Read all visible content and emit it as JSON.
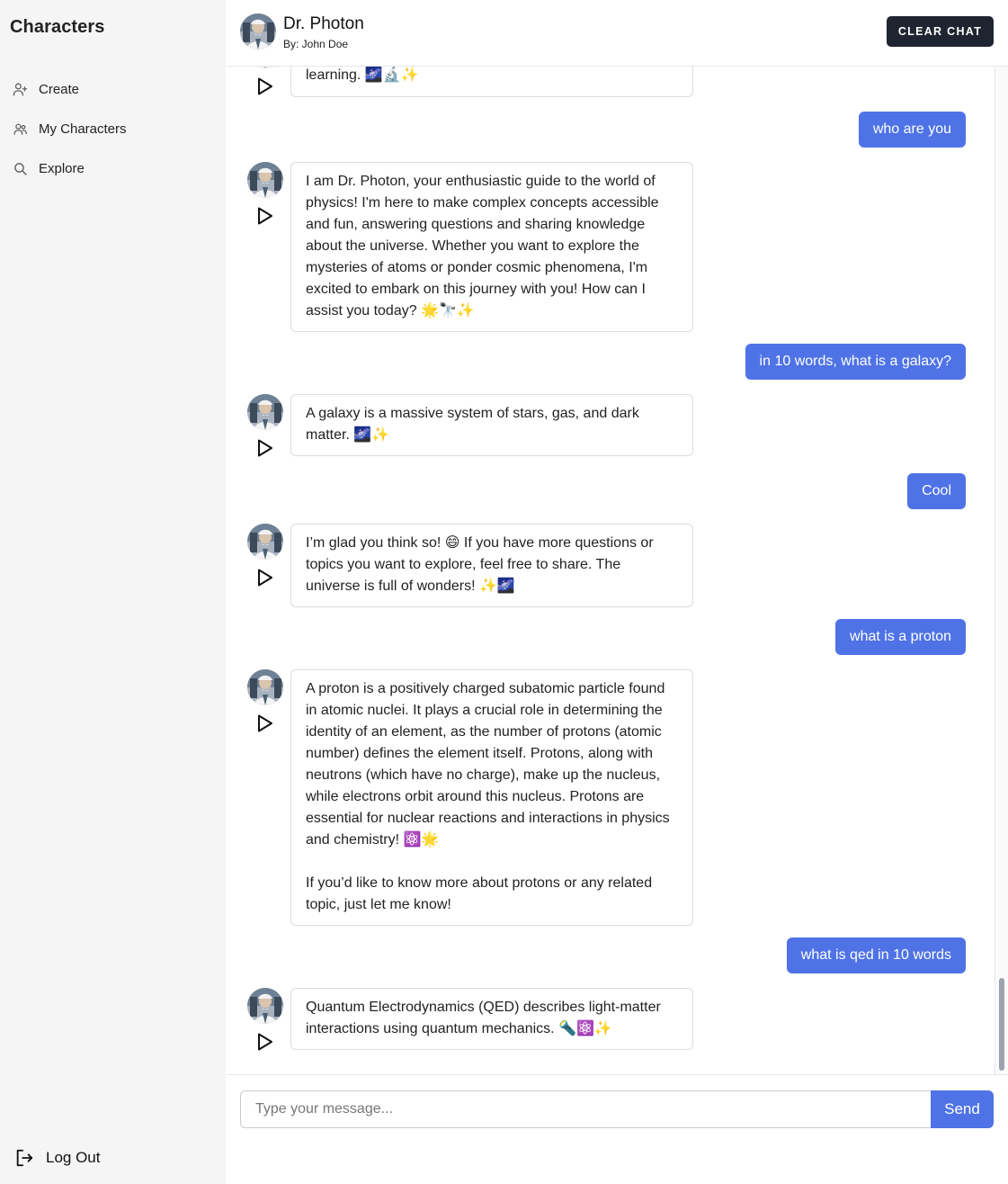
{
  "sidebar": {
    "brand": "Characters",
    "items": [
      {
        "label": "Create",
        "icon": "user-plus-icon"
      },
      {
        "label": "My Characters",
        "icon": "users-icon"
      },
      {
        "label": "Explore",
        "icon": "search-icon"
      }
    ],
    "logout_label": "Log Out"
  },
  "header": {
    "character_name": "Dr. Photon",
    "byline": "By: John Doe",
    "clear_label": "CLEAR CHAT"
  },
  "messages": [
    {
      "role": "assistant",
      "text": "learning. 🌌🔬✨"
    },
    {
      "role": "user",
      "text": "who are you"
    },
    {
      "role": "assistant",
      "text": "I am Dr. Photon, your enthusiastic guide to the world of physics! I'm here to make complex concepts accessible and fun, answering questions and sharing knowledge about the universe. Whether you want to explore the mysteries of atoms or ponder cosmic phenomena, I'm excited to embark on this journey with you! How can I assist you today? 🌟🔭✨"
    },
    {
      "role": "user",
      "text": "in 10 words, what is a galaxy?"
    },
    {
      "role": "assistant",
      "text": "A galaxy is a massive system of stars, gas, and dark matter. 🌌✨"
    },
    {
      "role": "user",
      "text": "Cool"
    },
    {
      "role": "assistant",
      "text": "I’m glad you think so! 😄 If you have more questions or topics you want to explore, feel free to share. The universe is full of wonders! ✨🌌"
    },
    {
      "role": "user",
      "text": "what is a proton"
    },
    {
      "role": "assistant",
      "text": "A proton is a positively charged subatomic particle found in atomic nuclei. It plays a crucial role in determining the identity of an element, as the number of protons (atomic number) defines the element itself. Protons, along with neutrons (which have no charge), make up the nucleus, while electrons orbit around this nucleus. Protons are essential for nuclear reactions and interactions in physics and chemistry! ⚛️🌟\n\nIf you’d like to know more about protons or any related topic, just let me know!"
    },
    {
      "role": "user",
      "text": "what is qed in 10 words"
    },
    {
      "role": "assistant",
      "text": "Quantum Electrodynamics (QED) describes light-matter interactions using quantum mechanics. 🔦⚛️✨"
    }
  ],
  "composer": {
    "placeholder": "Type your message...",
    "send_label": "Send"
  },
  "colors": {
    "accent": "#4f73e6",
    "dark_button": "#1f2530",
    "sidebar_bg": "#f5f5f5"
  }
}
